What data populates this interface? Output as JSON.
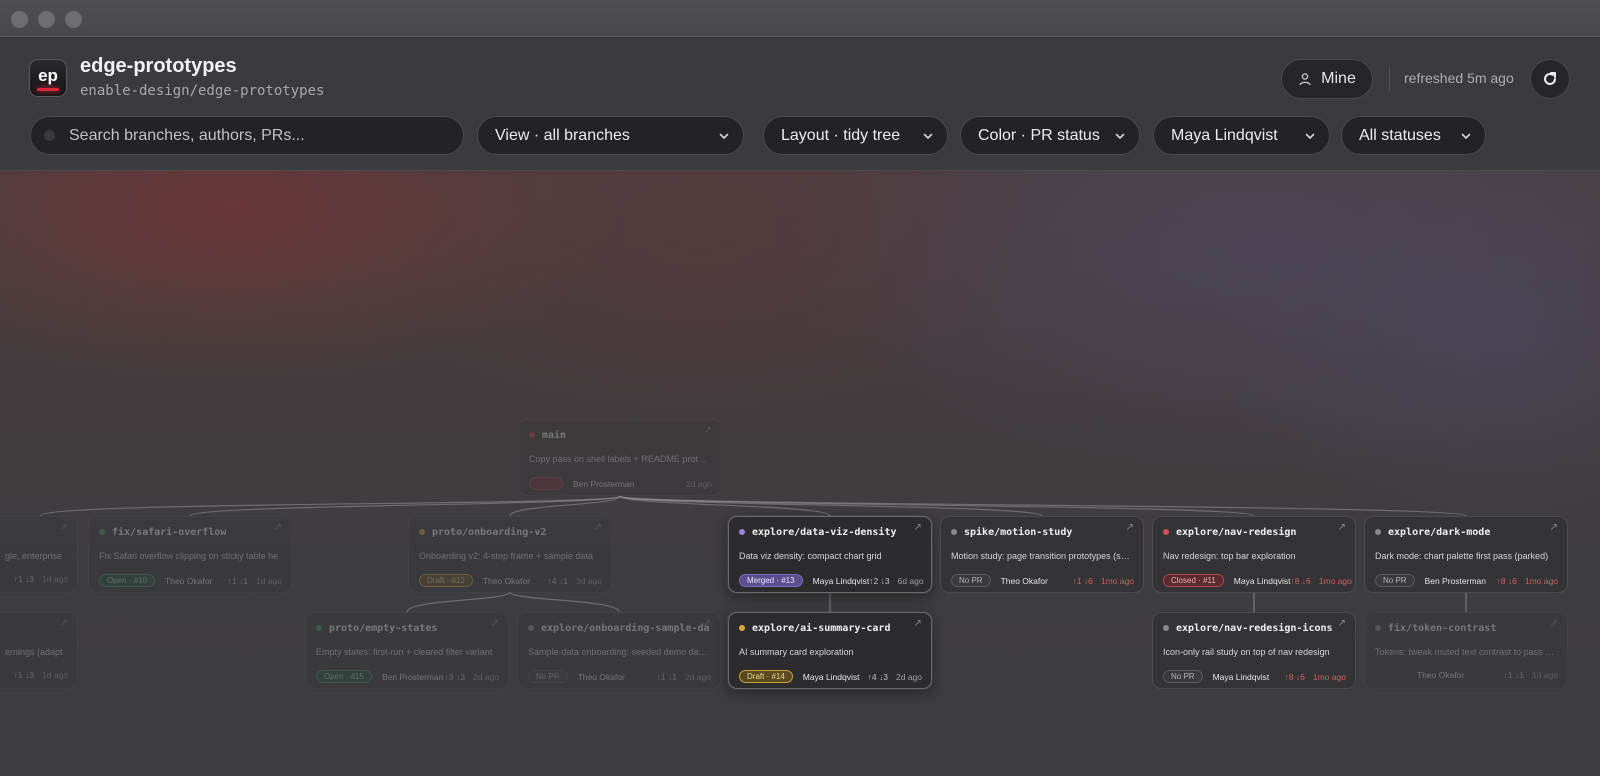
{
  "window": {
    "traffic_lights": [
      "close",
      "minimize",
      "zoom"
    ]
  },
  "header": {
    "app_icon_text": "ep",
    "title": "edge-prototypes",
    "repo_path": "enable-design/edge-prototypes",
    "mine_label": "Mine",
    "refreshed": "refreshed 5m ago"
  },
  "toolbar": {
    "search_placeholder": "Search branches, authors, PRs...",
    "view": "View · all branches",
    "layout": "Layout · tidy tree",
    "color": "Color · PR status",
    "author": "Maya Lindqvist",
    "status": "All statuses"
  },
  "colors": {
    "accent_red": "#e0253a",
    "merged": "#7a6cc0",
    "draft": "#c9a23a",
    "closed": "#b04850",
    "open": "#3a9a6a"
  },
  "branches": {
    "main": {
      "name": "main",
      "message": "Copy pass on shell labels + README prototyp...",
      "pr": "",
      "author": "Ben Prosterman",
      "stats": "",
      "time": "2d ago",
      "dot": "#c0404a"
    },
    "fix_safari": {
      "name": "fix/safari-overflow",
      "message": "Fix Safari overflow clipping on sticky table he",
      "pr": "Open · #10",
      "author": "Theo Okafor",
      "stats": "↑1 ↓1",
      "time": "1d ago",
      "dot": "#3aa070"
    },
    "proto_onboarding": {
      "name": "proto/onboarding-v2",
      "message": "Onboarding v2: 4-step frame + sample data",
      "pr": "Draft · #12",
      "author": "Theo Okafor",
      "stats": "↑4 ↓1",
      "time": "3d ago",
      "dot": "#c9a23a"
    },
    "explore_dataviz": {
      "name": "explore/data-viz-density",
      "message": "Data viz density: compact chart grid",
      "pr": "Merged · #13",
      "author": "Maya Lindqvist",
      "stats": "↑2 ↓3",
      "time": "6d ago",
      "dot": "#9a88e0"
    },
    "spike_motion": {
      "name": "spike/motion-study",
      "message": "Motion study: page transition prototypes (spr...",
      "pr": "No PR",
      "author": "Theo Okafor",
      "stats": "↑1 ↓6",
      "time": "1mo ago",
      "dot": "#8a8a8e"
    },
    "explore_nav": {
      "name": "explore/nav-redesign",
      "message": "Nav redesign: top bar exploration",
      "pr": "Closed · #11",
      "author": "Maya Lindqvist",
      "stats": "↑8 ↓6",
      "time": "1mo ago",
      "dot": "#d05058"
    },
    "explore_dark": {
      "name": "explore/dark-mode",
      "message": "Dark mode: chart palette first pass (parked)",
      "pr": "No PR",
      "author": "Ben Prosterman",
      "stats": "↑8 ↓6",
      "time": "1mo ago",
      "dot": "#8a8a8e"
    },
    "left_top": {
      "name": "",
      "message": "gle, enterprise",
      "pr": "",
      "author": "",
      "stats": "↑1 ↓3",
      "time": "1d ago",
      "dot": "#8a8a8e"
    },
    "left_bottom": {
      "name": "",
      "message": "ernings (adapt",
      "pr": "",
      "author": "",
      "stats": "↑1 ↓3",
      "time": "1d ago",
      "dot": "#8a8a8e"
    },
    "proto_empty": {
      "name": "proto/empty-states",
      "message": "Empty states: first-run + cleared filter variant",
      "pr": "Open · #15",
      "author": "Ben Prosterman",
      "stats": "↑3 ↓3",
      "time": "2d ago",
      "dot": "#3aa070"
    },
    "explore_onboarding_sample": {
      "name": "explore/onboarding-sample-data",
      "message": "Sample-data onboarding: seeded demo datas...",
      "pr": "No PR",
      "author": "Theo Okafor",
      "stats": "↑1 ↓1",
      "time": "2d ago",
      "dot": "#8a8a8e"
    },
    "explore_ai": {
      "name": "explore/ai-summary-card",
      "message": "AI summary card exploration",
      "pr": "Draft · #14",
      "author": "Maya Lindqvist",
      "stats": "↑4 ↓3",
      "time": "2d ago",
      "dot": "#e0a83a"
    },
    "explore_nav_icons": {
      "name": "explore/nav-redesign-icons",
      "message": "Icon-only rail study on top of nav redesign",
      "pr": "No PR",
      "author": "Maya Lindqvist",
      "stats": "↑8 ↓6",
      "time": "1mo ago",
      "dot": "#8a8a8e"
    },
    "fix_token": {
      "name": "fix/token-contrast",
      "message": "Tokens: tweak muted text contrast to pass a...",
      "pr": "",
      "author": "Theo Okafor",
      "stats": "↑1 ↓1",
      "time": "1d ago",
      "dot": "#8a8a8e"
    }
  }
}
